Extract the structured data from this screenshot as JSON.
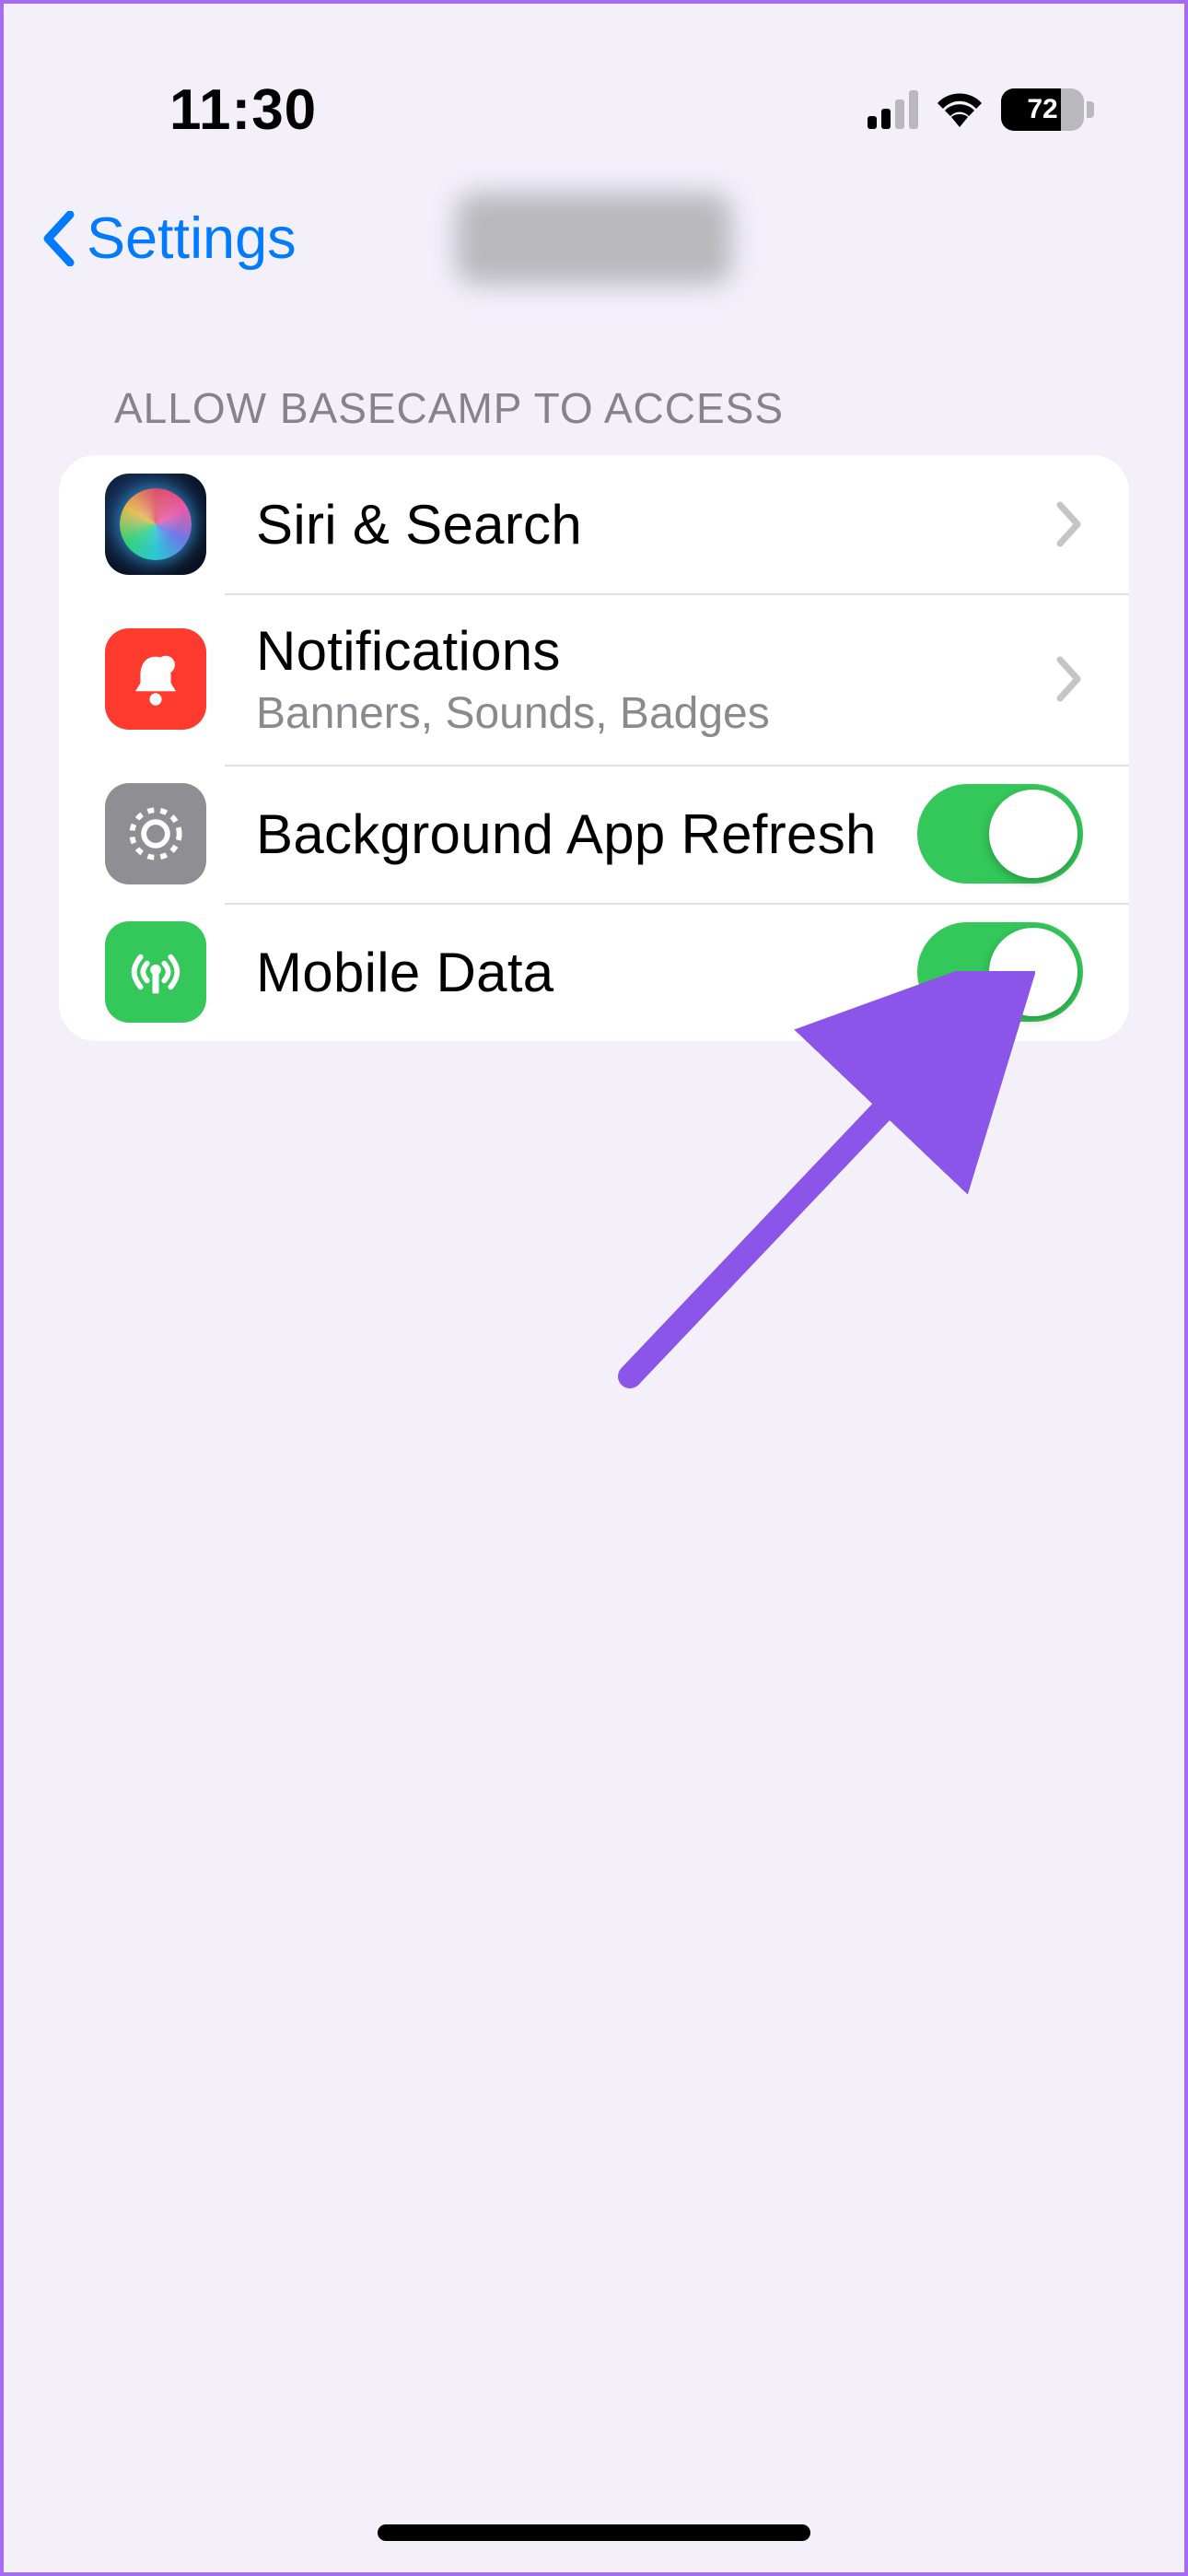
{
  "status": {
    "time": "11:30",
    "cell_active_bars": 2,
    "battery_percent": "72"
  },
  "nav": {
    "back_label": "Settings"
  },
  "section_header": "ALLOW BASECAMP TO ACCESS",
  "rows": {
    "siri": {
      "title": "Siri & Search"
    },
    "notif": {
      "title": "Notifications",
      "subtitle": "Banners, Sounds, Badges"
    },
    "bg": {
      "title": "Background App Refresh",
      "toggle_on": true
    },
    "data": {
      "title": "Mobile Data",
      "toggle_on": true
    }
  }
}
